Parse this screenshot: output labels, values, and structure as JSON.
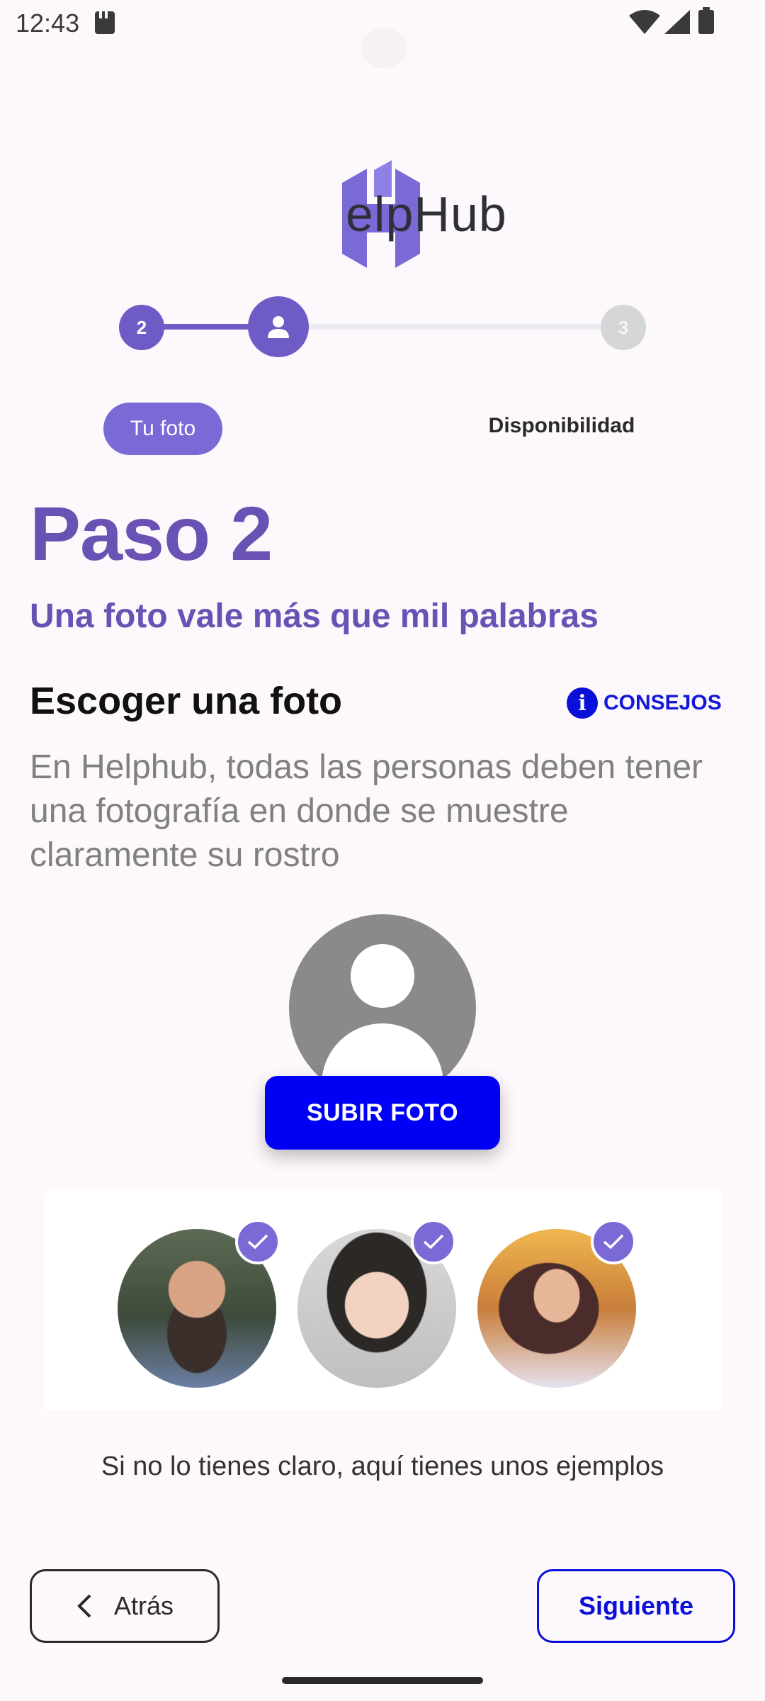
{
  "status_bar": {
    "time": "12:43"
  },
  "logo": {
    "text": "elpHub",
    "brand_color": "#7a6ad6"
  },
  "stepper": {
    "prev_step_number": "2",
    "current_step_icon": "person-icon",
    "next_step_number": "3",
    "current_label": "Tu foto",
    "next_label": "Disponibilidad",
    "accent": "#6f5bc6"
  },
  "main": {
    "step_title": "Paso 2",
    "step_subtitle": "Una foto vale más que mil palabras",
    "section_title": "Escoger una foto",
    "tips_label": "CONSEJOS",
    "description": "En Helphub, todas las personas deben tener una fotografía en donde se muestre claramente su rostro",
    "upload_button": "SUBIR FOTO",
    "examples_caption": "Si no lo tienes claro, aquí tienes unos ejemplos"
  },
  "footer": {
    "back_label": "Atrás",
    "next_label": "Siguiente",
    "primary_color": "#0a10d8"
  }
}
